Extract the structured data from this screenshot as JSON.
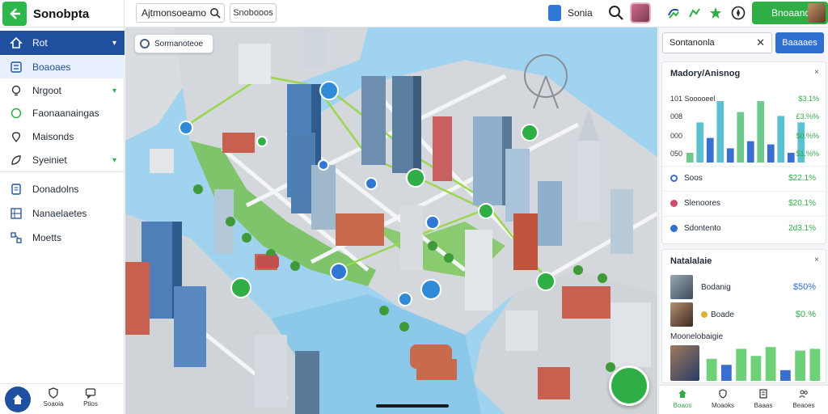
{
  "app": {
    "title": "Sonobpta",
    "search_value": "Ajtmonsoeamot",
    "chip_label": "Snobooos",
    "map_label": "Sonia",
    "cta_label": "Bnoaanc"
  },
  "sidebar": {
    "items": [
      {
        "label": "Rot",
        "icon": "home-icon",
        "state": "active",
        "chevron": true
      },
      {
        "label": "Boaoaes",
        "icon": "list-icon",
        "state": "selected",
        "chevron": false
      },
      {
        "label": "Nrgoot",
        "icon": "bulb-icon",
        "state": "normal",
        "chevron": true
      },
      {
        "label": "Faonaanaingas",
        "icon": "circle-icon",
        "state": "normal",
        "chevron": false
      },
      {
        "label": "Maisonds",
        "icon": "pin-icon",
        "state": "normal",
        "chevron": false
      },
      {
        "label": "Syeiniet",
        "icon": "leaf-icon",
        "state": "normal",
        "chevron": true
      },
      {
        "label": "Donadolns",
        "icon": "doc-icon",
        "state": "normal",
        "chevron": false
      },
      {
        "label": "Nanaelaetes",
        "icon": "grid-icon",
        "state": "normal",
        "chevron": false
      },
      {
        "label": "Moetts",
        "icon": "network-icon",
        "state": "normal",
        "chevron": false
      }
    ],
    "bottom_tabs": [
      {
        "label": "Soaoia",
        "icon": "shield-icon"
      },
      {
        "label": "Ptios",
        "icon": "chat-icon"
      }
    ]
  },
  "map": {
    "chip_label": "Sormanoteoe"
  },
  "right_panel": {
    "search_value": "Sontanonla",
    "search_button": "Baaaaes",
    "stats_card": {
      "title": "Madory/Anisnog",
      "chart_rows": [
        {
          "label": "101  Sooooeel",
          "value": "$3.1%"
        },
        {
          "label": "008",
          "value": "£3.%%"
        },
        {
          "label": "000",
          "value": "$0.%%"
        },
        {
          "label": "050",
          "value": "$1.%%"
        }
      ],
      "rows": [
        {
          "label": "Soos",
          "value": "$22.1%",
          "color": "#3a6fc9"
        },
        {
          "label": "Slenoores",
          "value": "$20.1%",
          "color": "#d04a6a"
        },
        {
          "label": "Sdontento",
          "value": "2d3.1%",
          "color": "#2f6fd0"
        }
      ]
    },
    "chart_data": {
      "type": "bar",
      "series": [
        {
          "name": "",
          "values": [
            0.15,
            0.62,
            0.38,
            0.95,
            0.22,
            0.78,
            0.33,
            0.95,
            0.28,
            0.72,
            0.15,
            0.62
          ]
        }
      ],
      "colors": [
        "#6fc98b",
        "#5bc0d0",
        "#3a6fd0",
        "#5bc0d0",
        "#3a6fd0",
        "#6fc98b",
        "#3a6fd0",
        "#6fc98b",
        "#3a6fd0",
        "#5bc0d0",
        "#3a6fd0",
        "#5bc0d0"
      ]
    },
    "team_card": {
      "title": "Natalalaie",
      "rows": [
        {
          "name": "Bodanig",
          "value": "$50%"
        },
        {
          "name": "Boade",
          "value": "$0.%"
        }
      ],
      "subtitle": "Moonelobaigie"
    },
    "team_chart": {
      "type": "bar",
      "series": [
        {
          "name": "",
          "values": [
            0.62,
            0.45,
            0.9,
            0.7,
            0.95,
            0.3,
            0.85,
            0.9
          ]
        }
      ],
      "colors": [
        "#6fd07a",
        "#3a6fd0",
        "#6fd07a",
        "#6fd07a",
        "#6fd07a",
        "#3a6fd0",
        "#6fd07a",
        "#6fd07a"
      ]
    },
    "tabs": [
      {
        "label": "Boaos",
        "icon": "home-icon",
        "active": true
      },
      {
        "label": "Moaoks",
        "icon": "shield-icon",
        "active": false
      },
      {
        "label": "Baaas",
        "icon": "doc-icon",
        "active": false
      },
      {
        "label": "Beaoes",
        "icon": "people-icon",
        "active": false
      }
    ]
  }
}
